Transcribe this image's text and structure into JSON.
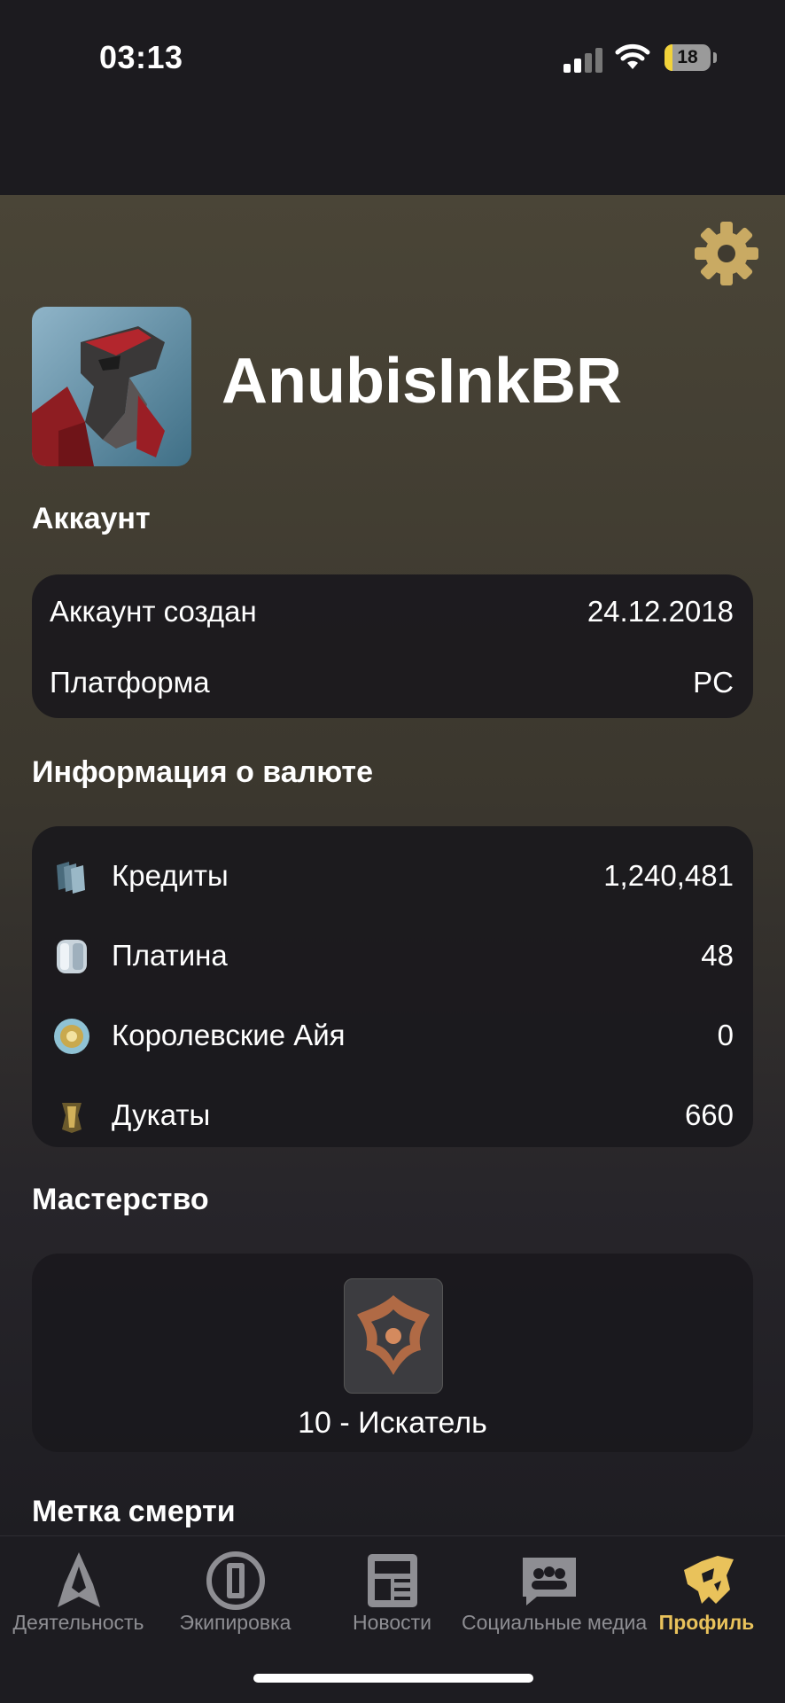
{
  "status_bar": {
    "time": "03:13",
    "battery": "18",
    "battery_level": 0.18
  },
  "profile": {
    "username": "AnubisInkBR"
  },
  "account": {
    "title": "Аккаунт",
    "rows": [
      {
        "label": "Аккаунт создан",
        "value": "24.12.2018"
      },
      {
        "label": "Платформа",
        "value": "PC"
      }
    ]
  },
  "currency": {
    "title": "Информация о валюте",
    "rows": [
      {
        "label": "Кредиты",
        "value": "1,240,481",
        "icon": "credits-icon"
      },
      {
        "label": "Платина",
        "value": "48",
        "icon": "platinum-icon"
      },
      {
        "label": "Королевские Айя",
        "value": "0",
        "icon": "regal-aya-icon"
      },
      {
        "label": "Дукаты",
        "value": "660",
        "icon": "ducats-icon"
      }
    ]
  },
  "mastery": {
    "title": "Мастерство",
    "rank": "10 - Искатель"
  },
  "death_mark": {
    "title": "Метка смерти"
  },
  "tabs": [
    {
      "label": "Деятельность",
      "icon": "activity-icon"
    },
    {
      "label": "Экипировка",
      "icon": "equipment-icon"
    },
    {
      "label": "Новости",
      "icon": "news-icon"
    },
    {
      "label": "Социальные медиа",
      "icon": "social-media-icon"
    },
    {
      "label": "Профиль",
      "icon": "profile-icon",
      "active": true
    }
  ],
  "colors": {
    "accent": "#e9c25b",
    "card": "#1a191d",
    "tab_inactive": "#8e8e93"
  }
}
